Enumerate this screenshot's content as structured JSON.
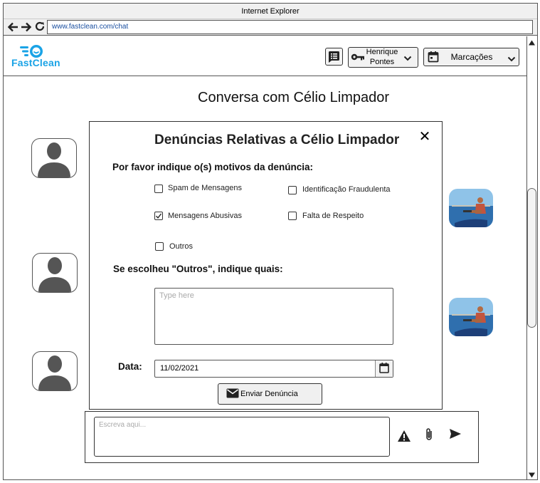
{
  "browser": {
    "title": "Internet Explorer",
    "url": "www.fastclean.com/chat"
  },
  "header": {
    "logo_text": "FastClean",
    "user_line1": "Henrique",
    "user_line2": "Pontes",
    "appointments_label": "Marcações"
  },
  "conversation": {
    "title": "Conversa com Célio Limpador"
  },
  "report_modal": {
    "title": "Denúncias Relativas a Célio Limpador",
    "close_symbol": "✕",
    "reasons_question": "Por favor indique o(s) motivos da denúncia:",
    "options": [
      {
        "label": "Spam de Mensagens",
        "checked": false
      },
      {
        "label": "Identificação Fraudulenta",
        "checked": false
      },
      {
        "label": "Mensagens Abusivas",
        "checked": true
      },
      {
        "label": "Falta de Respeito",
        "checked": false
      },
      {
        "label": "Outros",
        "checked": false
      }
    ],
    "others_question": "Se escolheu \"Outros\", indique quais:",
    "others_placeholder": "Type here",
    "date_label": "Data:",
    "date_value": "11/02/2021",
    "submit_label": "Enviar Denúncia"
  },
  "composer": {
    "placeholder": "Escreva aqui..."
  },
  "colors": {
    "brand": "#1aa3e6",
    "border": "#333333"
  }
}
